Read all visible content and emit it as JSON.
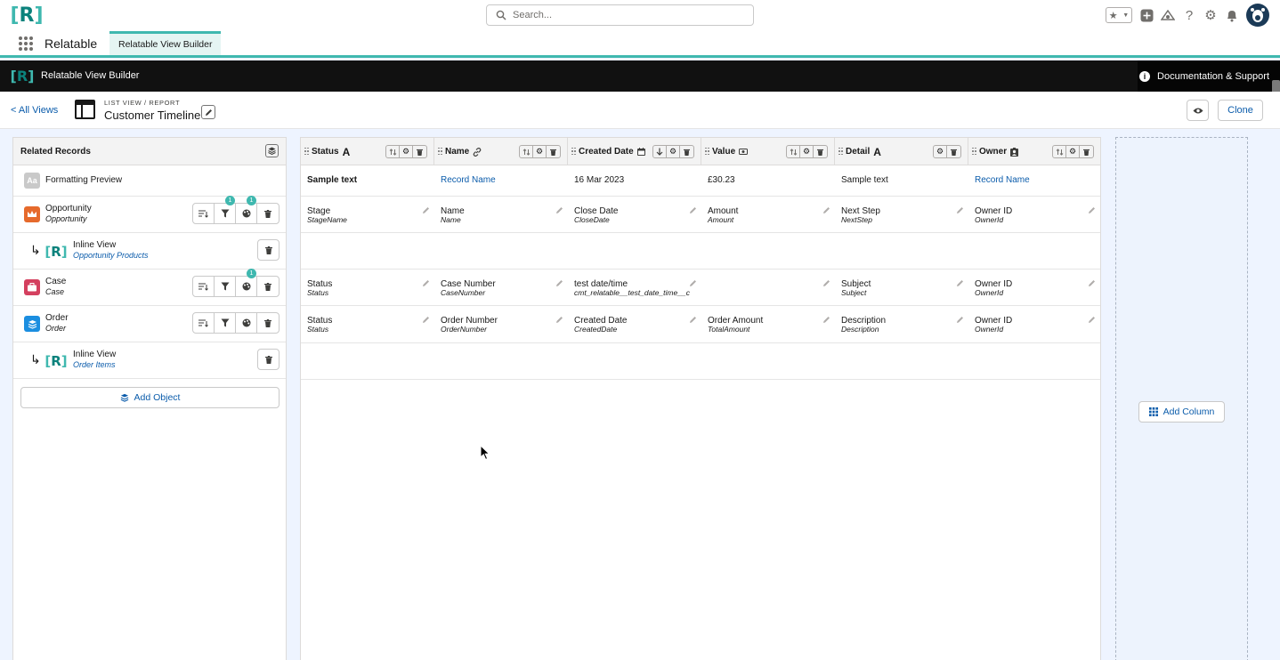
{
  "global": {
    "search_placeholder": "Search..."
  },
  "nav": {
    "app_name": "Relatable",
    "tab": "Relatable View Builder"
  },
  "header": {
    "title": "Relatable View Builder",
    "docs": "Documentation & Support"
  },
  "page": {
    "back": "< All Views",
    "eyebrow": "LIST VIEW / REPORT",
    "title": "Customer Timeline",
    "clone": "Clone"
  },
  "left_panel": {
    "title": "Related Records",
    "formatting_preview": "Formatting Preview",
    "objects": [
      {
        "name": "Opportunity",
        "api": "Opportunity",
        "color": "#e66a2c",
        "filter_badge": "1",
        "color_badge": "1"
      },
      {
        "name": "Inline View",
        "api": "Opportunity Products"
      },
      {
        "name": "Case",
        "api": "Case",
        "color": "#d4405f",
        "color_badge": "1"
      },
      {
        "name": "Order",
        "api": "Order",
        "color": "#1b8ee0"
      },
      {
        "name": "Inline View",
        "api": "Order Items"
      }
    ],
    "add_object": "Add Object"
  },
  "columns": [
    {
      "label": "Status",
      "type_icon": "text-icon"
    },
    {
      "label": "Name",
      "type_icon": "link-icon"
    },
    {
      "label": "Created Date",
      "type_icon": "calendar-icon"
    },
    {
      "label": "Value",
      "type_icon": "currency-icon"
    },
    {
      "label": "Detail",
      "type_icon": "text-icon"
    },
    {
      "label": "Owner",
      "type_icon": "user-icon"
    }
  ],
  "preview_row": [
    "Sample text",
    "Record Name",
    "16 Mar 2023",
    "£30.23",
    "Sample text",
    "Record Name"
  ],
  "rows": [
    [
      {
        "n": "Stage",
        "a": "StageName"
      },
      {
        "n": "Name",
        "a": "Name"
      },
      {
        "n": "Close Date",
        "a": "CloseDate"
      },
      {
        "n": "Amount",
        "a": "Amount"
      },
      {
        "n": "Next Step",
        "a": "NextStep"
      },
      {
        "n": "Owner ID",
        "a": "OwnerId"
      }
    ],
    [
      {
        "n": "Status",
        "a": "Status"
      },
      {
        "n": "Case Number",
        "a": "CaseNumber"
      },
      {
        "n": "test date/time",
        "a": "cmt_relatable__test_date_time__c"
      },
      {
        "n": "",
        "a": ""
      },
      {
        "n": "Subject",
        "a": "Subject"
      },
      {
        "n": "Owner ID",
        "a": "OwnerId"
      }
    ],
    [
      {
        "n": "Status",
        "a": "Status"
      },
      {
        "n": "Order Number",
        "a": "OrderNumber"
      },
      {
        "n": "Created Date",
        "a": "CreatedDate"
      },
      {
        "n": "Order Amount",
        "a": "TotalAmount"
      },
      {
        "n": "Description",
        "a": "Description"
      },
      {
        "n": "Owner ID",
        "a": "OwnerId"
      }
    ]
  ],
  "add_column": "Add Column",
  "colors": {
    "accent": "#3fb8af",
    "brand": "#0b827c",
    "link": "#0b5cab"
  }
}
